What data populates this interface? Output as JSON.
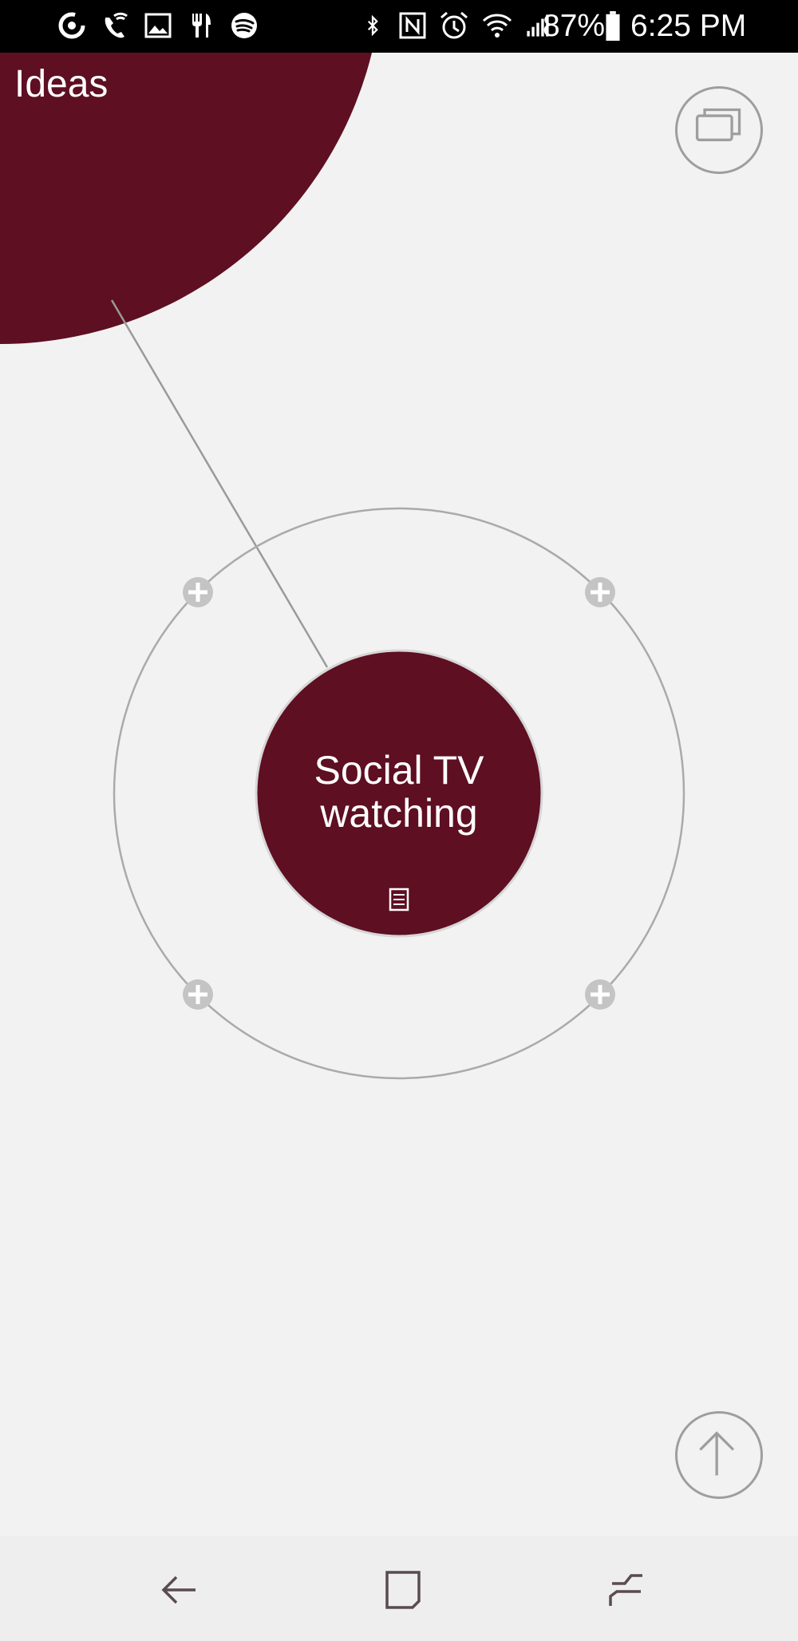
{
  "status_bar": {
    "battery_percent": "87%",
    "time": "6:25 PM",
    "left_icons": [
      "data-saver-icon",
      "wifi-call-icon",
      "image-icon",
      "restaurant-icon",
      "spotify-icon"
    ],
    "right_icons": [
      "bluetooth-icon",
      "nfc-icon",
      "alarm-icon",
      "wifi-icon",
      "signal-icon",
      "battery-icon"
    ]
  },
  "mindmap": {
    "parent_node": {
      "title": "Ideas",
      "color": "#5e0f22"
    },
    "focused_node": {
      "title_line1": "Social TV",
      "title_line2": "watching",
      "color": "#5e0f22",
      "note_icon": "note-icon"
    },
    "add_child_icon": "plus-icon",
    "ring_color": "#aaaaaa"
  },
  "buttons": {
    "view_switch_icon": "multiple-windows-icon",
    "up_icon": "arrow-up-icon"
  },
  "nav_bar": {
    "back_icon": "back-icon",
    "home_icon": "home-icon",
    "recents_icon": "recents-icon"
  }
}
